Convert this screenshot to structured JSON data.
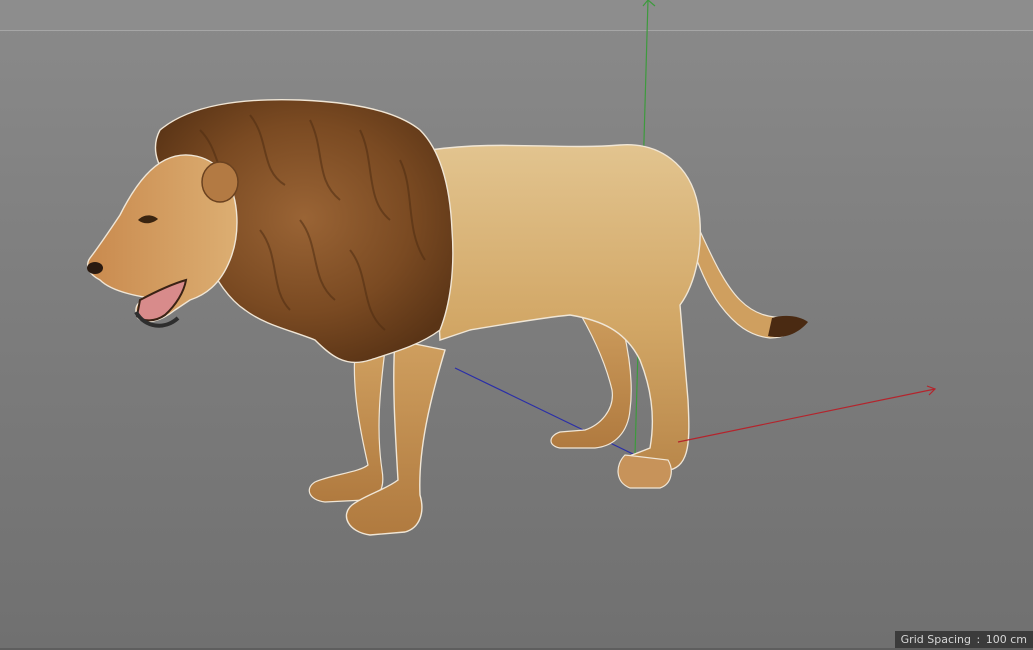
{
  "viewport": {
    "hud": {
      "grid_spacing_label": "Grid Spacing",
      "separator": ":",
      "grid_spacing_value": "100 cm"
    }
  },
  "scene": {
    "model": "lion",
    "axis_colors": {
      "x": "#b4242c",
      "y": "#3d9a3d",
      "z": "#2a2ea8"
    },
    "colors": {
      "background_top": "#8a8a8a",
      "background_bottom": "#707070",
      "hud_background": "#3b3b3b"
    }
  }
}
